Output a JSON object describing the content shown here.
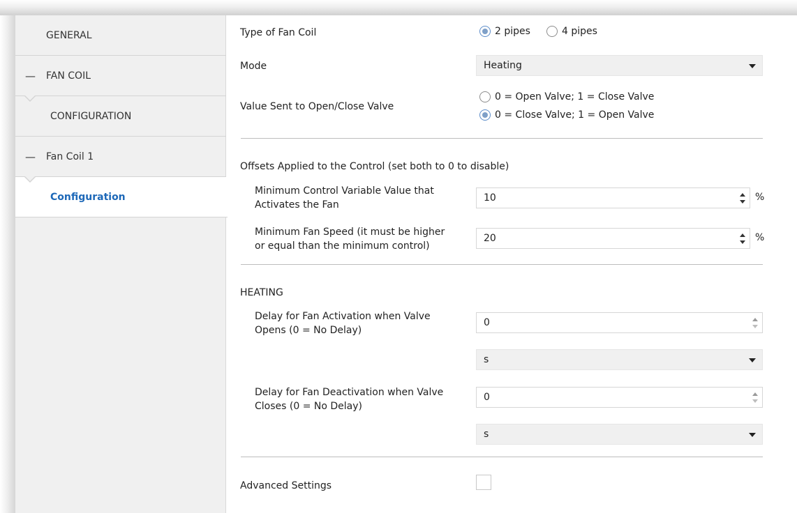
{
  "sidebar": {
    "items": [
      {
        "label": "GENERAL",
        "dash": ""
      },
      {
        "label": "FAN COIL",
        "dash": "—"
      },
      {
        "label": "CONFIGURATION",
        "dash": ""
      },
      {
        "label": "Fan Coil 1",
        "dash": "—"
      },
      {
        "label": "Configuration",
        "dash": ""
      }
    ]
  },
  "form": {
    "type_label": "Type of Fan Coil",
    "type_options": [
      "2 pipes",
      "4 pipes"
    ],
    "type_selected": "2 pipes",
    "mode_label": "Mode",
    "mode_value": "Heating",
    "valve_label": "Value Sent to Open/Close Valve",
    "valve_options": [
      "0 = Open Valve; 1 = Close Valve",
      "0 = Close Valve; 1 = Open Valve"
    ],
    "valve_selected": "0 = Close Valve; 1 = Open Valve",
    "offsets_heading": "Offsets Applied to the Control (set both to 0 to disable)",
    "min_control_label_line1": "Minimum Control Variable Value that",
    "min_control_label_line2": "Activates the Fan",
    "min_control_value": "10",
    "min_control_unit": "%",
    "min_fan_label_line1": "Minimum Fan Speed (it must be higher",
    "min_fan_label_line2": "or equal than the minimum control)",
    "min_fan_value": "20",
    "min_fan_unit": "%",
    "heating_heading": "HEATING",
    "delay_act_label_line1": "Delay for Fan Activation when Valve",
    "delay_act_label_line2": "Opens (0 = No Delay)",
    "delay_act_value": "0",
    "delay_act_unit": "s",
    "delay_deact_label_line1": "Delay for Fan Deactivation when Valve",
    "delay_deact_label_line2": "Closes (0 = No Delay)",
    "delay_deact_value": "0",
    "delay_deact_unit": "s",
    "advanced_label": "Advanced Settings",
    "advanced_checked": false
  }
}
